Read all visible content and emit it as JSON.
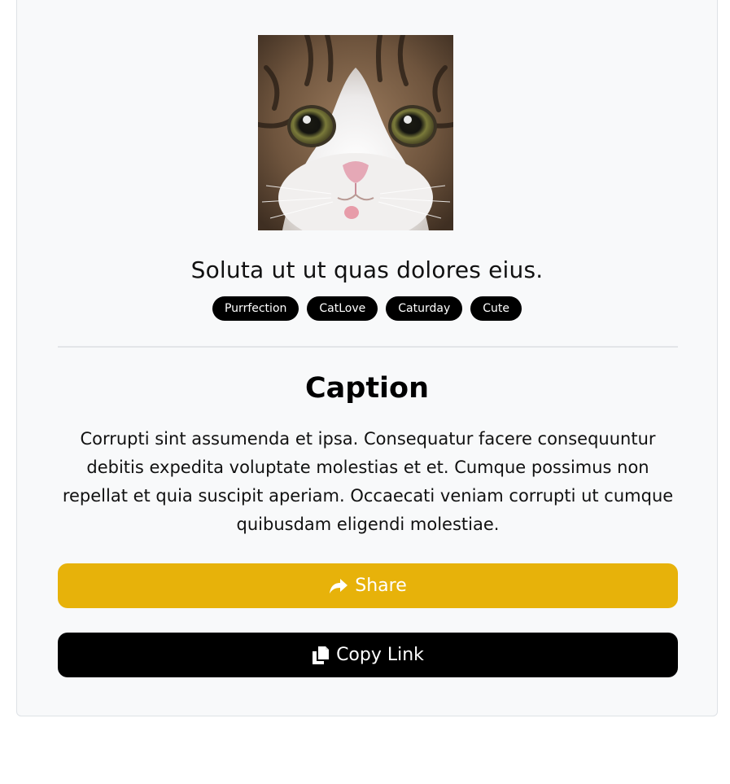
{
  "post": {
    "image_alt": "Cat face close-up",
    "title": "Soluta ut ut quas dolores eius.",
    "tags": [
      "Purrfection",
      "CatLove",
      "Caturday",
      "Cute"
    ]
  },
  "caption": {
    "heading": "Caption",
    "text": "Corrupti sint assumenda et ipsa. Consequatur facere consequuntur debitis expedita voluptate molestias et et. Cumque possimus non repellat et quia suscipit aperiam. Occaecati veniam corrupti ut cumque quibusdam eligendi molestiae."
  },
  "actions": {
    "share_label": "Share",
    "share_icon": "share-arrow-icon",
    "copy_label": "Copy Link",
    "copy_icon": "copy-icon"
  },
  "colors": {
    "share_button": "#e7b20a",
    "copy_button": "#000000",
    "tag_background": "#000000",
    "card_background": "#f8f9fa"
  }
}
